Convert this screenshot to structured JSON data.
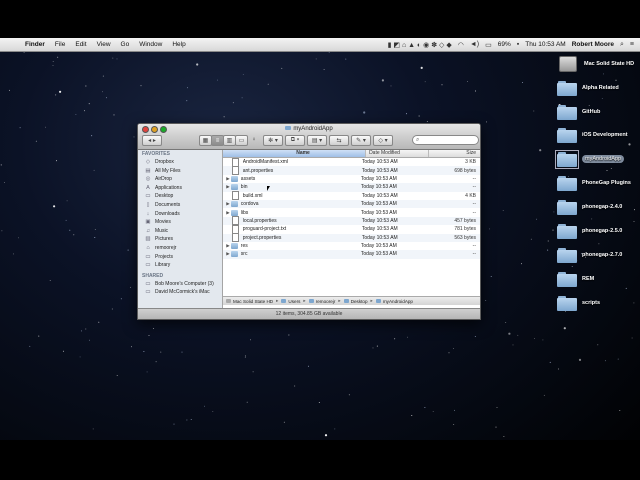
{
  "menubar": {
    "apple_icon": "apple-icon",
    "items": [
      "Finder",
      "File",
      "Edit",
      "View",
      "Go",
      "Window",
      "Help"
    ],
    "battery": "69%",
    "clock": "Thu 10:53 AM",
    "user": "Robert Moore"
  },
  "desktop": {
    "items": [
      {
        "label": "Mac Solid State HD",
        "icon": "hard-drive-icon"
      },
      {
        "label": "Alpha Related",
        "icon": "folder-icon"
      },
      {
        "label": "GitHub",
        "icon": "folder-icon"
      },
      {
        "label": "iOS Development",
        "icon": "folder-icon"
      },
      {
        "label": "myAndroidApp",
        "icon": "folder-icon"
      },
      {
        "label": "PhoneGap Plugins",
        "icon": "folder-icon"
      },
      {
        "label": "phonegap-2.4.0",
        "icon": "folder-icon"
      },
      {
        "label": "phonegap-2.5.0",
        "icon": "folder-icon"
      },
      {
        "label": "phonegap-2.7.0",
        "icon": "folder-icon"
      },
      {
        "label": "REM",
        "icon": "folder-icon"
      },
      {
        "label": "scripts",
        "icon": "folder-icon"
      }
    ]
  },
  "finder": {
    "title": "myAndroidApp",
    "search_placeholder": "",
    "sidebar": {
      "favorites_header": "FAVORITES",
      "favorites": [
        {
          "label": "Dropbox",
          "icon": "dropbox-icon"
        },
        {
          "label": "All My Files",
          "icon": "all-files-icon"
        },
        {
          "label": "AirDrop",
          "icon": "airdrop-icon"
        },
        {
          "label": "Applications",
          "icon": "applications-icon"
        },
        {
          "label": "Desktop",
          "icon": "desktop-icon"
        },
        {
          "label": "Documents",
          "icon": "documents-icon"
        },
        {
          "label": "Downloads",
          "icon": "downloads-icon"
        },
        {
          "label": "Movies",
          "icon": "movies-icon"
        },
        {
          "label": "Music",
          "icon": "music-icon"
        },
        {
          "label": "Pictures",
          "icon": "pictures-icon"
        },
        {
          "label": "remoorejr",
          "icon": "home-icon"
        },
        {
          "label": "Projects",
          "icon": "folder-icon"
        },
        {
          "label": "Library",
          "icon": "folder-icon"
        }
      ],
      "shared_header": "SHARED",
      "shared": [
        {
          "label": "Bob Moore's Computer (3)",
          "icon": "computer-icon"
        },
        {
          "label": "David McCormick's iMac",
          "icon": "computer-icon"
        }
      ]
    },
    "columns": {
      "name": "Name",
      "date": "Date Modified",
      "size": "Size"
    },
    "files": [
      {
        "name": "AndroidManifest.xml",
        "date": "Today 10:53 AM",
        "size": "3 KB",
        "kind": "doc"
      },
      {
        "name": "ant.properties",
        "date": "Today 10:53 AM",
        "size": "698 bytes",
        "kind": "doc"
      },
      {
        "name": "assets",
        "date": "Today 10:53 AM",
        "size": "--",
        "kind": "folder"
      },
      {
        "name": "bin",
        "date": "Today 10:53 AM",
        "size": "--",
        "kind": "folder"
      },
      {
        "name": "build.xml",
        "date": "Today 10:53 AM",
        "size": "4 KB",
        "kind": "doc"
      },
      {
        "name": "cordova",
        "date": "Today 10:53 AM",
        "size": "--",
        "kind": "folder"
      },
      {
        "name": "libs",
        "date": "Today 10:53 AM",
        "size": "--",
        "kind": "folder"
      },
      {
        "name": "local.properties",
        "date": "Today 10:53 AM",
        "size": "457 bytes",
        "kind": "doc"
      },
      {
        "name": "proguard-project.txt",
        "date": "Today 10:53 AM",
        "size": "781 bytes",
        "kind": "doc"
      },
      {
        "name": "project.properties",
        "date": "Today 10:53 AM",
        "size": "563 bytes",
        "kind": "doc"
      },
      {
        "name": "res",
        "date": "Today 10:53 AM",
        "size": "--",
        "kind": "folder"
      },
      {
        "name": "src",
        "date": "Today 10:53 AM",
        "size": "--",
        "kind": "folder"
      }
    ],
    "path": [
      "Mac Solid State HD",
      "Users",
      "remoorejr",
      "Desktop",
      "myAndroidApp"
    ],
    "status": "12 items, 304.85 GB available"
  }
}
